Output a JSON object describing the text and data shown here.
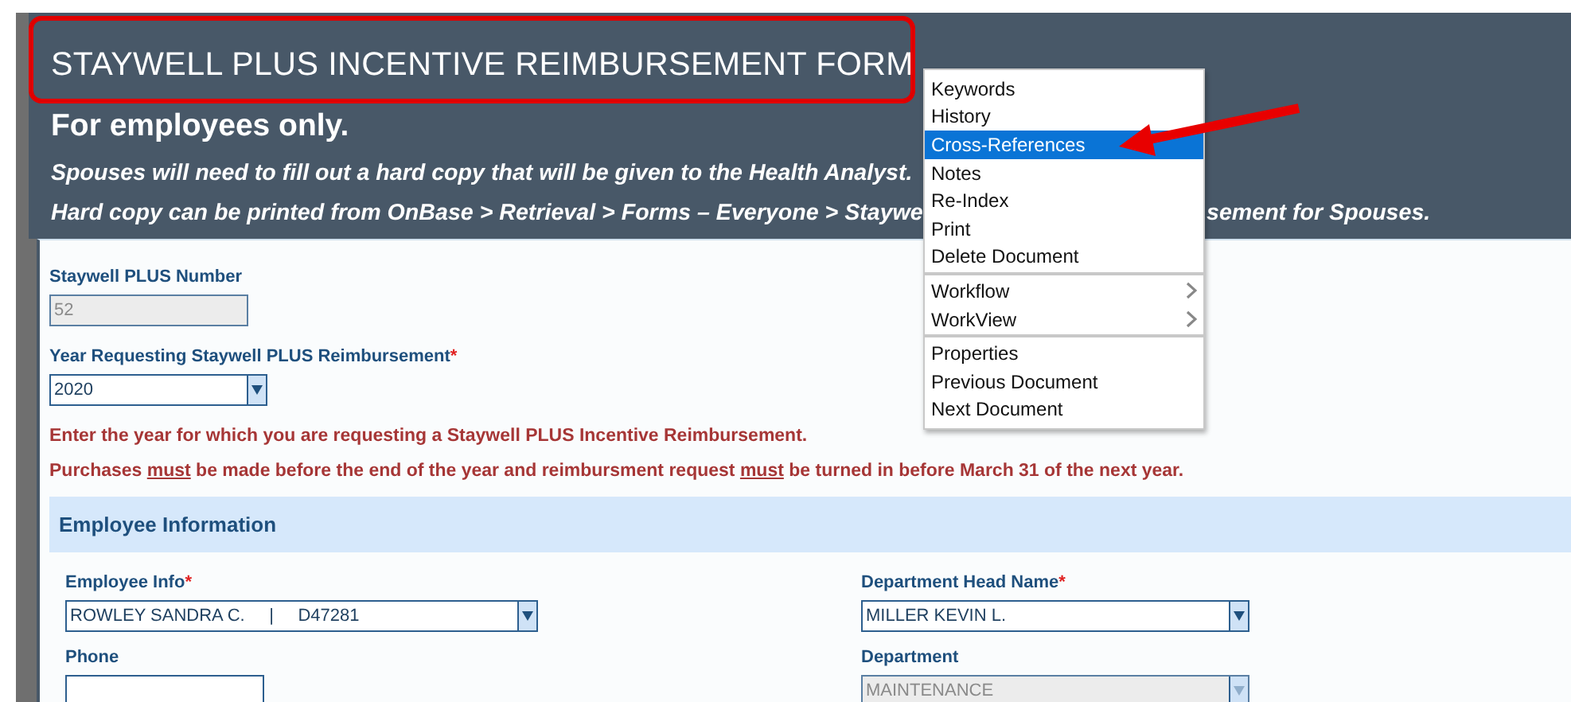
{
  "header": {
    "title": "STAYWELL PLUS INCENTIVE REIMBURSEMENT FORM",
    "subtitle": "For employees only.",
    "notes": [
      [
        "Spouses will need to fill out a hard copy that will be given to the Health Analyst."
      ],
      [
        "Hard copy can be printed from OnBase > Retrieval > Forms – Everyone > Staywe",
        "sement for Spouses."
      ]
    ]
  },
  "form": {
    "fields": [
      {
        "label": "Staywell PLUS Number",
        "kind": "text",
        "value": "52",
        "disabled": true
      },
      {
        "label": "Year Requesting Staywell PLUS Reimbursement",
        "kind": "select",
        "value": "2020",
        "disabled": false,
        "required_mark": "*"
      }
    ],
    "messages": [
      [
        {
          "text": "Enter the year for which you are requesting a Staywell PLUS Incentive Reimbursement.",
          "underline": false
        }
      ],
      [
        {
          "text": "Purchases ",
          "underline": false
        },
        {
          "text": "must",
          "underline": true
        },
        {
          "text": " be made before the end of the year and reimbursment request ",
          "underline": false
        },
        {
          "text": "must",
          "underline": true
        },
        {
          "text": " be turned in before March 31 of the next year.",
          "underline": false
        }
      ]
    ]
  },
  "section": {
    "title": "Employee Information",
    "columns": [
      [
        {
          "label": "Employee Info",
          "kind": "select",
          "value": "ROWLEY SANDRA C.     |     D47281",
          "disabled": false,
          "required_mark": "*"
        },
        {
          "label": "Phone",
          "kind": "text",
          "disabled": false
        }
      ],
      [
        {
          "label": "Department Head Name",
          "kind": "select",
          "value": "MILLER KEVIN L.",
          "disabled": false,
          "required_mark": "*"
        },
        {
          "label": "Department",
          "kind": "select",
          "value": "MAINTENANCE",
          "disabled": true
        }
      ]
    ]
  },
  "context_menu": {
    "groups": [
      [
        {
          "label": "Keywords",
          "selected": false,
          "submenu": false
        },
        {
          "label": "History",
          "selected": false,
          "submenu": false
        },
        {
          "label": "Cross-References",
          "selected": true,
          "submenu": false
        },
        {
          "label": "Notes",
          "selected": false,
          "submenu": false
        },
        {
          "label": "Re-Index",
          "selected": false,
          "submenu": false
        },
        {
          "label": "Print",
          "selected": false,
          "submenu": false
        },
        {
          "label": "Delete Document",
          "selected": false,
          "submenu": false
        }
      ],
      [
        {
          "label": "Workflow",
          "selected": false,
          "submenu": true
        },
        {
          "label": "WorkView",
          "selected": false,
          "submenu": true
        }
      ],
      [
        {
          "label": "Properties",
          "selected": false,
          "submenu": false
        },
        {
          "label": "Previous Document",
          "selected": false,
          "submenu": false
        },
        {
          "label": "Next Document",
          "selected": false,
          "submenu": false
        }
      ]
    ]
  }
}
